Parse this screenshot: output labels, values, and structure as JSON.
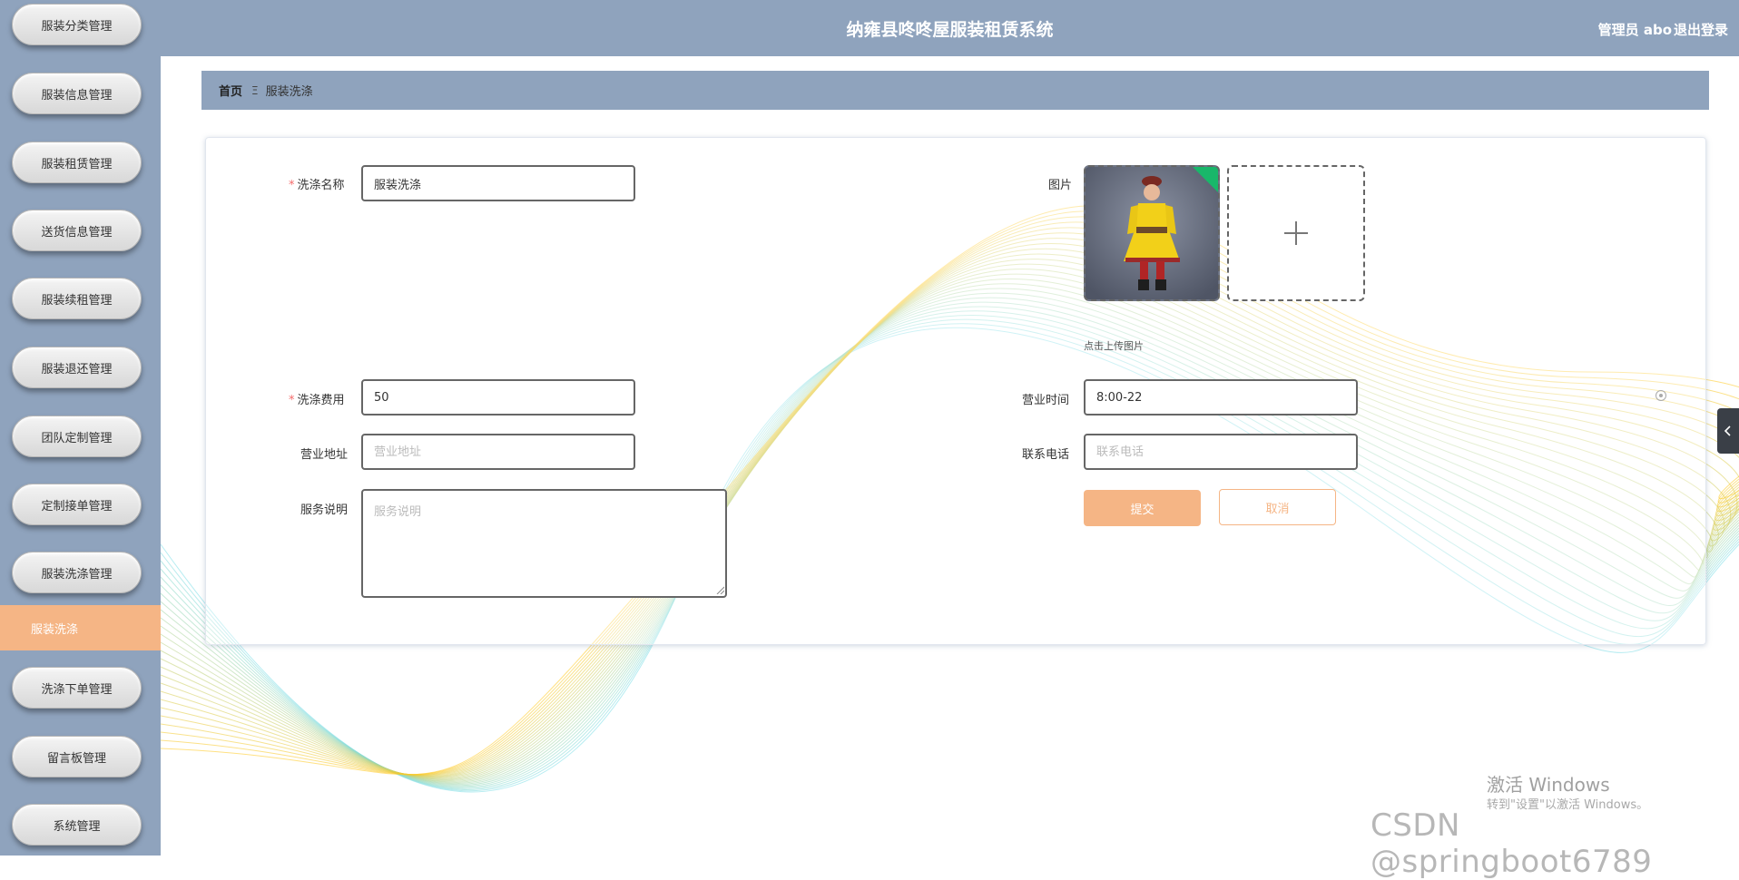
{
  "app": {
    "title": "纳雍县咚咚屋服装租赁系统",
    "user_label": "管理员 abo",
    "logout_label": "退出登录"
  },
  "sidebar": {
    "items": [
      {
        "label": "服装分类管理"
      },
      {
        "label": "服装信息管理"
      },
      {
        "label": "服装租赁管理"
      },
      {
        "label": "送货信息管理"
      },
      {
        "label": "服装续租管理"
      },
      {
        "label": "服装退还管理"
      },
      {
        "label": "团队定制管理"
      },
      {
        "label": "定制接单管理"
      },
      {
        "label": "服装洗涤管理"
      },
      {
        "label": "洗涤下单管理"
      },
      {
        "label": "留言板管理"
      },
      {
        "label": "系统管理"
      }
    ],
    "active_sub_item": "服装洗涤"
  },
  "breadcrumb": {
    "home": "首页",
    "separator": "Ξ",
    "current": "服装洗涤"
  },
  "form": {
    "wash_name": {
      "label": "洗涤名称",
      "required": true,
      "value": "服装洗涤"
    },
    "image": {
      "label": "图片",
      "hint": "点击上传图片",
      "add_icon": "plus-icon"
    },
    "wash_fee": {
      "label": "洗涤费用",
      "required": true,
      "value": "50"
    },
    "business_hours": {
      "label": "营业时间",
      "value": "8:00-22"
    },
    "address": {
      "label": "营业地址",
      "placeholder": "营业地址",
      "value": ""
    },
    "phone": {
      "label": "联系电话",
      "placeholder": "联系电话",
      "value": ""
    },
    "service_desc": {
      "label": "服务说明",
      "placeholder": "服务说明",
      "value": ""
    },
    "submit_label": "提交",
    "cancel_label": "取消",
    "required_mark": "*"
  },
  "colors": {
    "header_bg": "#8fa3bd",
    "accent": "#f5b585",
    "required": "#f56c6c"
  },
  "watermarks": {
    "windows_title": "激活 Windows",
    "windows_sub": "转到\"设置\"以激活 Windows。",
    "csdn": "CSDN @springboot6789"
  }
}
